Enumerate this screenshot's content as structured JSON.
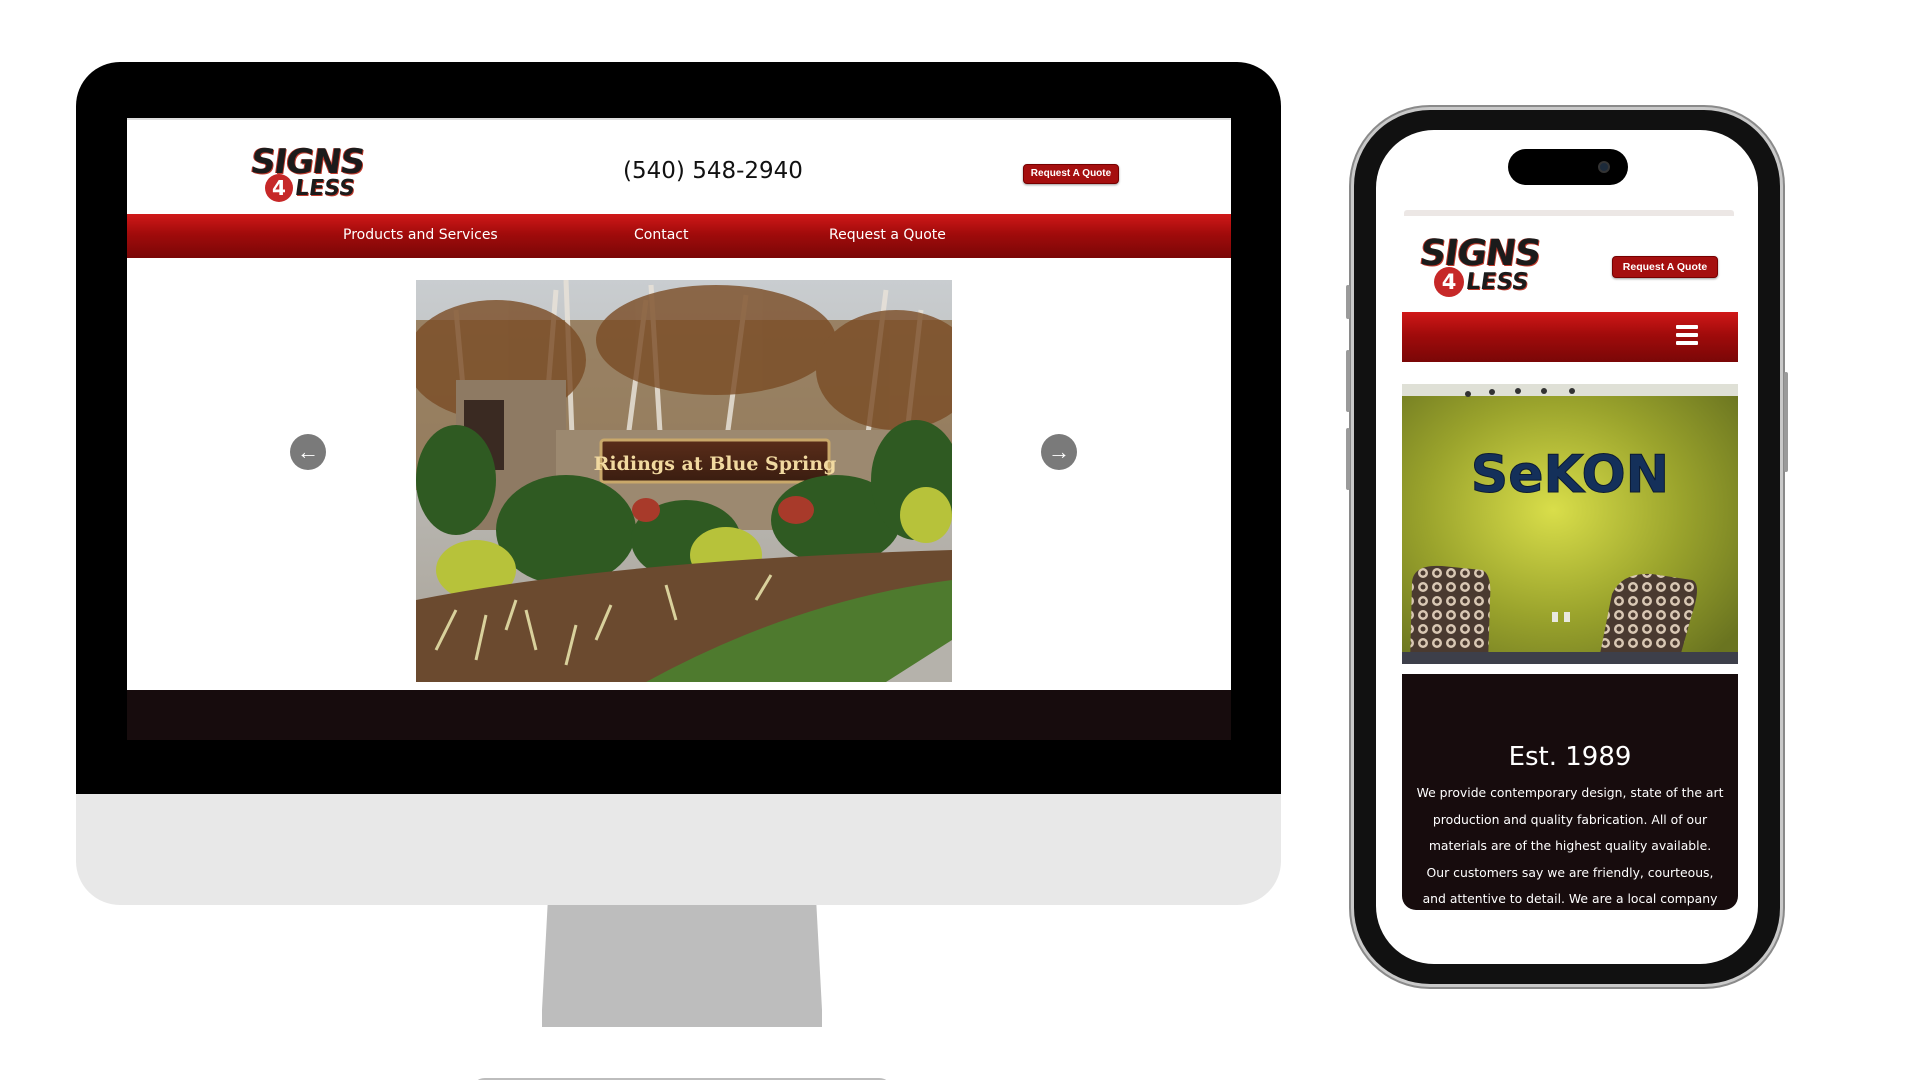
{
  "desktop": {
    "logo": {
      "line1": "SIGNS",
      "number": "4",
      "line2": "LESS"
    },
    "phone": "(540) 548-2940",
    "quote_button": "Request A Quote",
    "nav": {
      "products": "Products and Services",
      "contact": "Contact",
      "quote": "Request a Quote"
    },
    "slide_sign_text": "Ridings at Blue Spring",
    "arrow_left": "←",
    "arrow_right": "→"
  },
  "mobile": {
    "logo": {
      "line1": "SIGNS",
      "number": "4",
      "line2": "LESS"
    },
    "quote_button": "Request A Quote",
    "slide_wall_text": "SeKON",
    "about_title": "Est. 1989",
    "about_text": "We provide contemporary design, state of the art production and quality fabrication. All of our materials are of the highest quality available. Our customers say we are friendly, courteous, and attentive to detail. We are a local company"
  },
  "colors": {
    "brand_red": "#a50f0f",
    "footer_dark": "#170c0d",
    "wall_green": "#9aa32c"
  }
}
